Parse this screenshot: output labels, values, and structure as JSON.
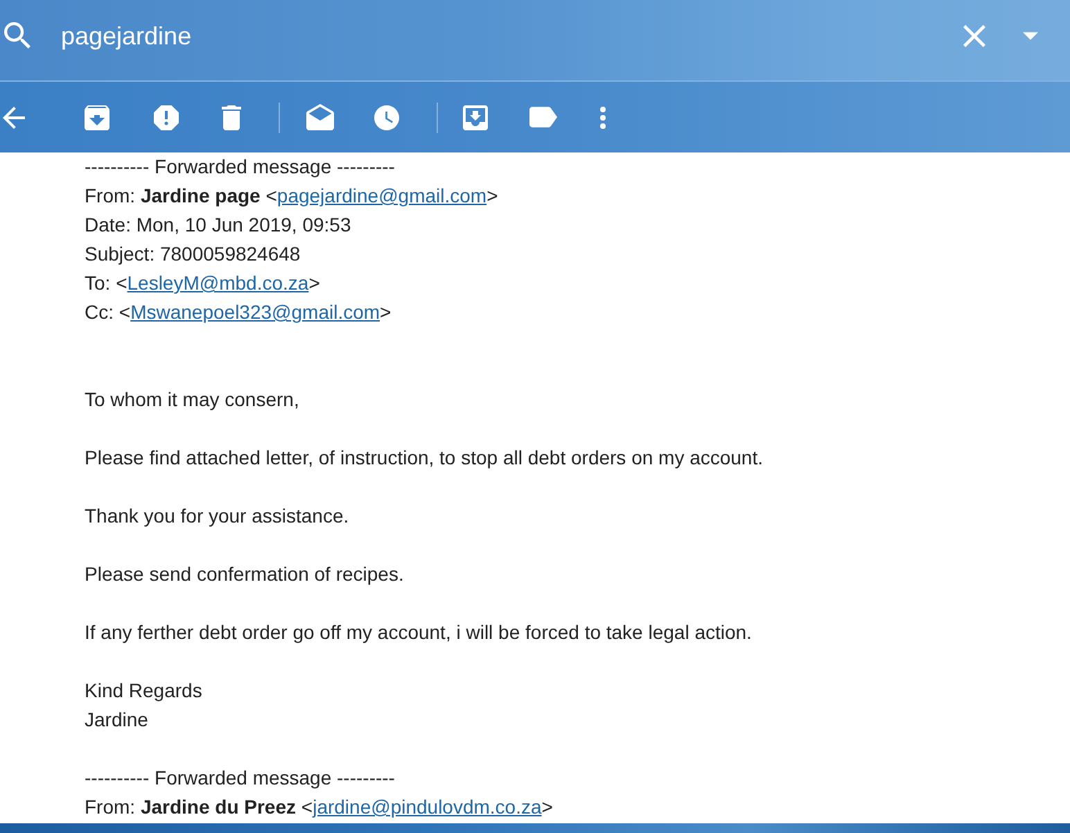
{
  "search": {
    "value": "pagejardine"
  },
  "message": {
    "forwarded_header": [
      {
        "kind": "separator",
        "text": "---------- Forwarded message ---------"
      },
      {
        "kind": "address",
        "before": "From: **Jardine page** <",
        "link": "pagejardine@gmail.com",
        "after": ">"
      },
      {
        "kind": "field",
        "text": "Date: Mon, 10 Jun 2019, 09:53"
      },
      {
        "kind": "field",
        "text": "Subject: 7800059824648"
      },
      {
        "kind": "address",
        "before": "To: <",
        "link": "LesleyM@mbd.co.za",
        "after": ">"
      },
      {
        "kind": "address",
        "before": "Cc: <",
        "link": "Mswanepoel323@gmail.com",
        "after": ">"
      }
    ],
    "body": [
      "To whom it may consern,",
      "Please find attached letter, of instruction, to stop all debt orders on my account.",
      "Thank you for your assistance.",
      "Please send confermation of recipes.",
      "If any ferther debt order go off my account, i will be forced to take legal action."
    ],
    "signoff": [
      "Kind Regards",
      "Jardine"
    ],
    "forwarded_header_2": [
      {
        "kind": "separator",
        "text": "---------- Forwarded message ---------"
      },
      {
        "kind": "address",
        "before": "From: **Jardine du Preez** <",
        "link": "jardine@pindulovdm.co.za",
        "after": ">"
      }
    ]
  }
}
